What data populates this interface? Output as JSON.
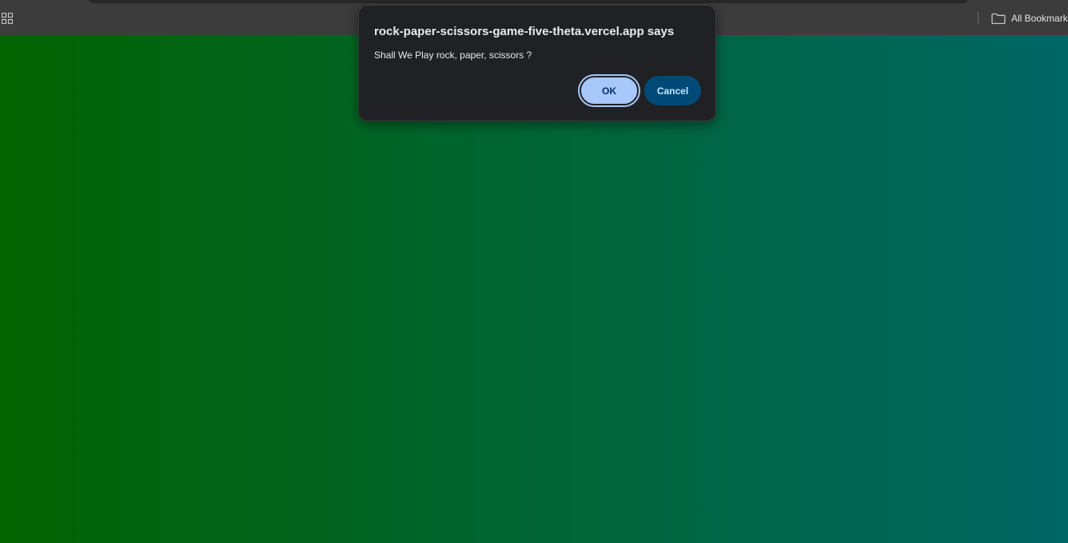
{
  "browser": {
    "bookmarks_bar": {
      "apps_icon": "apps-grid-icon",
      "all_bookmarks_label": "All Bookmarks",
      "all_bookmarks_icon": "folder-icon"
    }
  },
  "page": {
    "background_gradient": {
      "start_color": "#006400",
      "end_color": "#006666"
    }
  },
  "dialog": {
    "title": "rock-paper-scissors-game-five-theta.vercel.app says",
    "message": "Shall We Play rock, paper, scissors ?",
    "ok_label": "OK",
    "cancel_label": "Cancel"
  },
  "colors": {
    "dialog_bg": "#202124",
    "ok_bg": "#a8c7fa",
    "cancel_bg": "#004a77"
  }
}
